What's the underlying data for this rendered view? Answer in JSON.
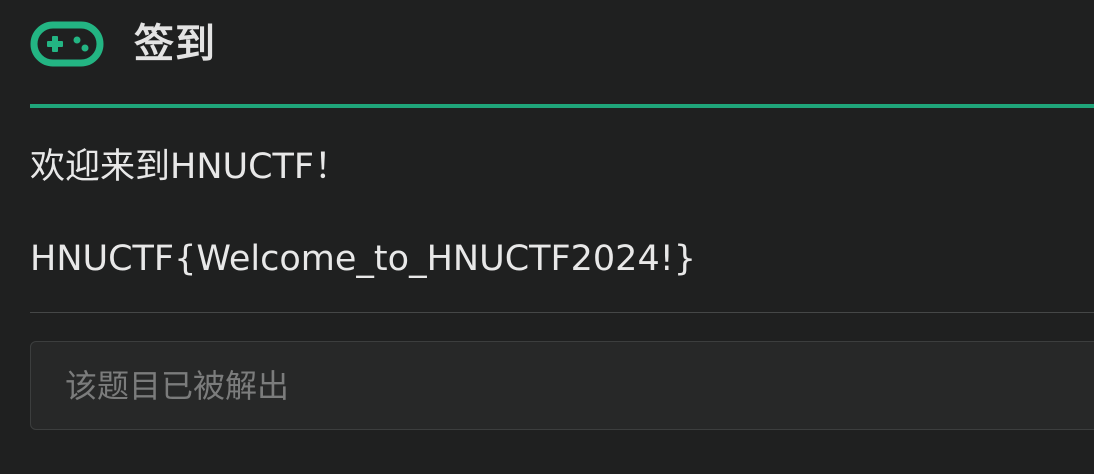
{
  "header": {
    "icon": "gamepad-icon",
    "title": "签到",
    "accent_color": "#1fa57a"
  },
  "challenge": {
    "welcome": "欢迎来到HNUCTF！",
    "flag": "HNUCTF{Welcome_to_HNUCTF2024!}"
  },
  "answer": {
    "placeholder": "该题目已被解出",
    "value": ""
  }
}
